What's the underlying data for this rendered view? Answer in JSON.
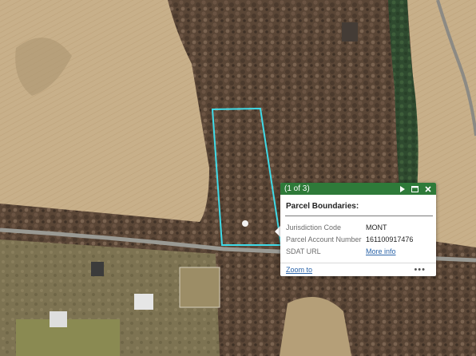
{
  "map": {
    "basemap": "aerial imagery",
    "parcel_outline_color": "#3fdbe8"
  },
  "popup": {
    "feature_count": "(1 of 3)",
    "title": "Parcel Boundaries:",
    "header_color": "#2e7a39",
    "header_icons": [
      "next-feature-icon",
      "maximize-icon",
      "close-icon"
    ],
    "attributes": [
      {
        "key": "Jurisdiction Code",
        "value": "MONT"
      },
      {
        "key": "Parcel Account Number",
        "value": "161100917476"
      },
      {
        "key": "SDAT URL",
        "value": "More info"
      }
    ],
    "zoom_label": "Zoom to",
    "more_label": "•••"
  }
}
